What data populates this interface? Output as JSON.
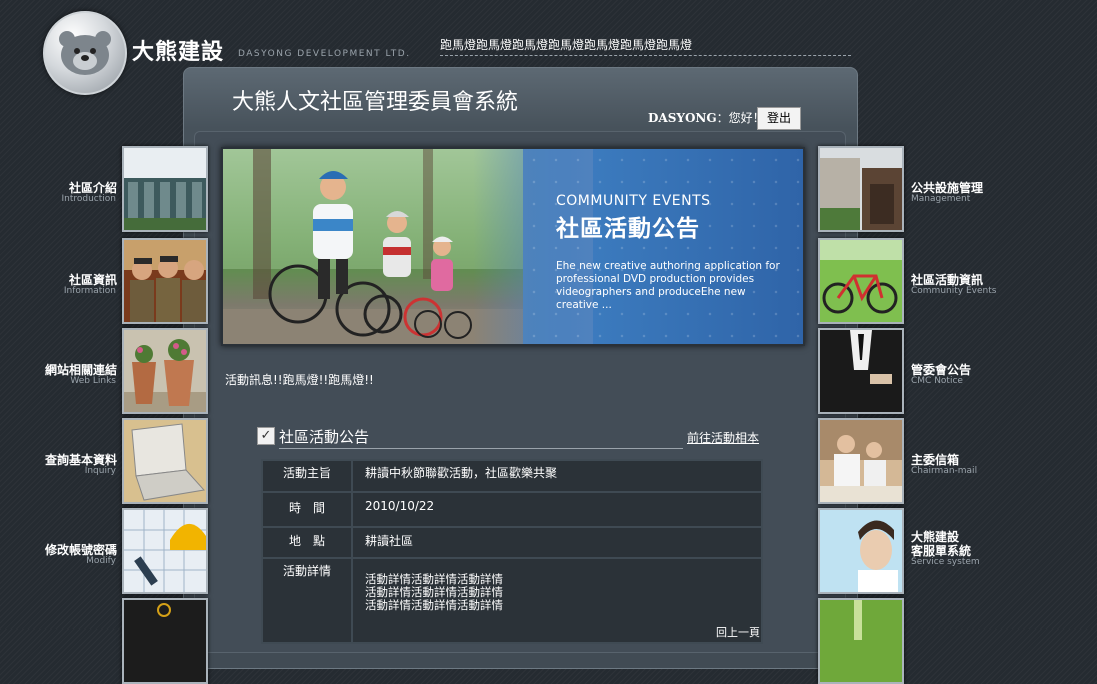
{
  "header": {
    "brand_name": "大熊建設",
    "brand_sub": "DASYONG DEVELOPMENT LTD.",
    "marquee": "跑馬燈跑馬燈跑馬燈跑馬燈跑馬燈跑馬燈跑馬燈"
  },
  "system_title": "大熊人文社區管理委員會系統",
  "user": {
    "name": "DASYONG",
    "greeting_suffix": "：您好！",
    "logout_label": "登出"
  },
  "banner": {
    "en": "COMMUNITY EVENTS",
    "zh": "社區活動公告",
    "desc": "Ehe new creative authoring application for professional DVD production provides videographers and produceEhe new creative ..."
  },
  "notice": "活動訊息!!跑馬燈!!跑馬燈!!",
  "section": {
    "title": "社區活動公告",
    "album_link": "前往活動相本"
  },
  "event": {
    "rows": [
      {
        "label": "活動主旨",
        "value": "耕讀中秋節聯歡活動，社區歡樂共聚"
      },
      {
        "label": "時　間",
        "value": "2010/10/22"
      },
      {
        "label": "地　點",
        "value": "耕讀社區"
      },
      {
        "label": "活動詳情",
        "lines": [
          "活動詳情活動詳情活動詳情",
          "活動詳情活動詳情活動詳情",
          "活動詳情活動詳情活動詳情"
        ]
      }
    ]
  },
  "page_nav": "回上一頁",
  "left_nav": [
    {
      "zh": "社區介紹",
      "en": "Introduction",
      "icon": "building-photo"
    },
    {
      "zh": "社區資訊",
      "en": "Information",
      "icon": "guards-photo"
    },
    {
      "zh": "網站相關連結",
      "en": "Web Links",
      "icon": "flowerpots-photo"
    },
    {
      "zh": "查詢基本資料",
      "en": "Inquiry",
      "icon": "laptop-photo"
    },
    {
      "zh": "修改帳號密碼",
      "en": "Modify",
      "icon": "blueprint-tools-photo"
    }
  ],
  "right_nav": [
    {
      "zh": "公共設施管理",
      "en": "Management",
      "icon": "house-photo"
    },
    {
      "zh": "社區活動資訊",
      "en": "Community Events",
      "icon": "bicycle-photo"
    },
    {
      "zh": "管委會公告",
      "en": "CMC Notice",
      "icon": "suit-photo"
    },
    {
      "zh": "主委信箱",
      "en": "Chairman-mail",
      "icon": "office-workers-photo"
    },
    {
      "zh": "大熊建設",
      "zh2": "客服單系統",
      "en": "Service system",
      "icon": "service-photo"
    }
  ]
}
